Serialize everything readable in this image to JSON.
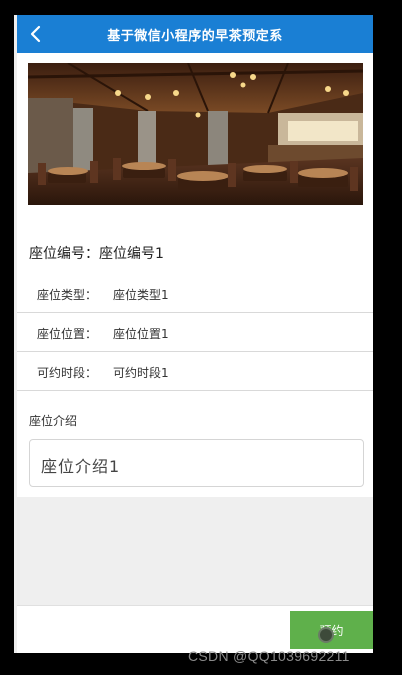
{
  "header": {
    "title": "基于微信小程序的早茶预定系",
    "back_icon": "chevron-left-icon"
  },
  "banner": {
    "icon": "restaurant-interior-photo"
  },
  "seat": {
    "title": "座位编号：座位编号1",
    "fields": [
      {
        "label": "座位类型：",
        "value": "座位类型1"
      },
      {
        "label": "座位位置：",
        "value": "座位位置1"
      },
      {
        "label": "可约时段：",
        "value": "可约时段1"
      }
    ],
    "intro_label": "座位介绍",
    "intro_value": "座位介绍1"
  },
  "footer": {
    "book_label": "预约"
  },
  "watermark": "CSDN @QQ1039692211",
  "colors": {
    "header": "#1a7fd4",
    "book_button": "#5fb04b",
    "background": "#efefef"
  }
}
